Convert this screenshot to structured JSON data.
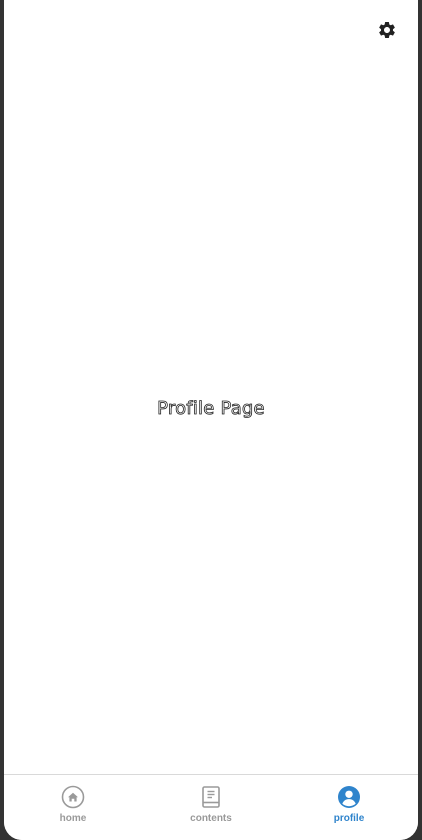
{
  "main": {
    "title": "Profile Page"
  },
  "header": {
    "settings_icon": "gear-icon"
  },
  "tabs": [
    {
      "label": "home",
      "icon": "home-icon",
      "active": false
    },
    {
      "label": "contents",
      "icon": "book-icon",
      "active": false
    },
    {
      "label": "profile",
      "icon": "profile-icon",
      "active": true
    }
  ],
  "colors": {
    "active_tab": "#2f84cc",
    "inactive_tab": "#9a9a9a",
    "background": "#ffffff"
  }
}
